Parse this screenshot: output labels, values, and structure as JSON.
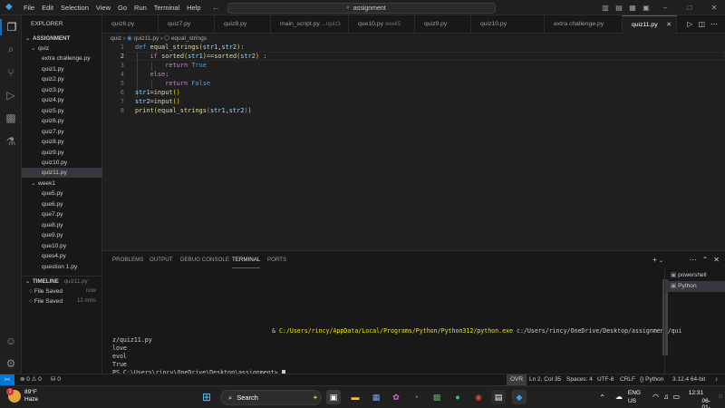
{
  "titlebar": {
    "menu": [
      "File",
      "Edit",
      "Selection",
      "View",
      "Go",
      "Run",
      "Terminal",
      "Help"
    ],
    "search_text": "assignment"
  },
  "sidebar": {
    "title": "EXPLORER",
    "root": "ASSIGNMENT",
    "folders": [
      {
        "name": "quiz",
        "files": [
          "extra challenge.py",
          "quiz1.py",
          "quiz2.py",
          "quiz3.py",
          "quiz4.py",
          "quiz5.py",
          "quiz6.py",
          "quiz7.py",
          "quiz8.py",
          "quiz9.py",
          "quiz10.py",
          "quiz11.py"
        ]
      },
      {
        "name": "week1",
        "files": [
          "que5.py",
          "que6.py",
          "que7.py",
          "que8.py",
          "que9.py",
          "que10.py",
          "ques4.py",
          "question 1.py"
        ]
      }
    ],
    "selected_file": "quiz11.py",
    "timeline": {
      "title": "TIMELINE",
      "file": "quiz11.py",
      "entries": [
        {
          "label": "File Saved",
          "time": "now"
        },
        {
          "label": "File Saved",
          "time": "12 mins"
        }
      ]
    }
  },
  "tabs": [
    {
      "label": "quiz6.py",
      "dim": ""
    },
    {
      "label": "quiz7.py",
      "dim": ""
    },
    {
      "label": "quiz8.py",
      "dim": ""
    },
    {
      "label": "main_script.py",
      "dim": "...\\quiz3"
    },
    {
      "label": "que10.py",
      "dim": "week5"
    },
    {
      "label": "quiz9.py",
      "dim": ""
    },
    {
      "label": "quiz10.py",
      "dim": ""
    },
    {
      "label": "extra challenge.py",
      "dim": ""
    },
    {
      "label": "quiz11.py",
      "dim": "",
      "active": true
    }
  ],
  "breadcrumb": [
    "quiz",
    "quiz11.py",
    "equal_strings"
  ],
  "editor": {
    "line_numbers": [
      "1",
      "2",
      "3",
      "4",
      "5",
      "6",
      "7",
      "8"
    ],
    "current_line": 2
  },
  "panel": {
    "tabs": [
      "PROBLEMS",
      "OUTPUT",
      "DEBUG CONSOLE",
      "TERMINAL",
      "PORTS"
    ],
    "active_tab": "TERMINAL",
    "terminals": [
      "powershell",
      "Python"
    ],
    "active_terminal": "Python",
    "output": {
      "command_prefix": "& ",
      "command_exe": "C:/Users/rincy/AppData/Local/Programs/Python/Python312/python.exe",
      "command_arg": " c:/Users/rincy/OneDrive/Desktop/assignment/qui",
      "wrap": "z/quiz11.py",
      "lines": [
        "love",
        "evol",
        "True"
      ],
      "prompt": "PS C:\\Users\\rincy\\OneDrive\\Desktop\\assignment> "
    }
  },
  "status": {
    "problems": "⊗ 0 ⚠ 0",
    "ports": "⛁ 0",
    "ovr": "OVR",
    "position": "Ln 2, Col 35",
    "spaces": "Spaces: 4",
    "encoding": "UTF-8",
    "eol": "CRLF",
    "language": "Python",
    "interpreter": "3.12.4 64-bit"
  },
  "taskbar": {
    "weather_temp": "89°F",
    "weather_desc": "Haze",
    "badge": "1",
    "search": "Search",
    "lang": "ENG",
    "region": "US",
    "time": "12:31",
    "date": "06-01-2025"
  }
}
